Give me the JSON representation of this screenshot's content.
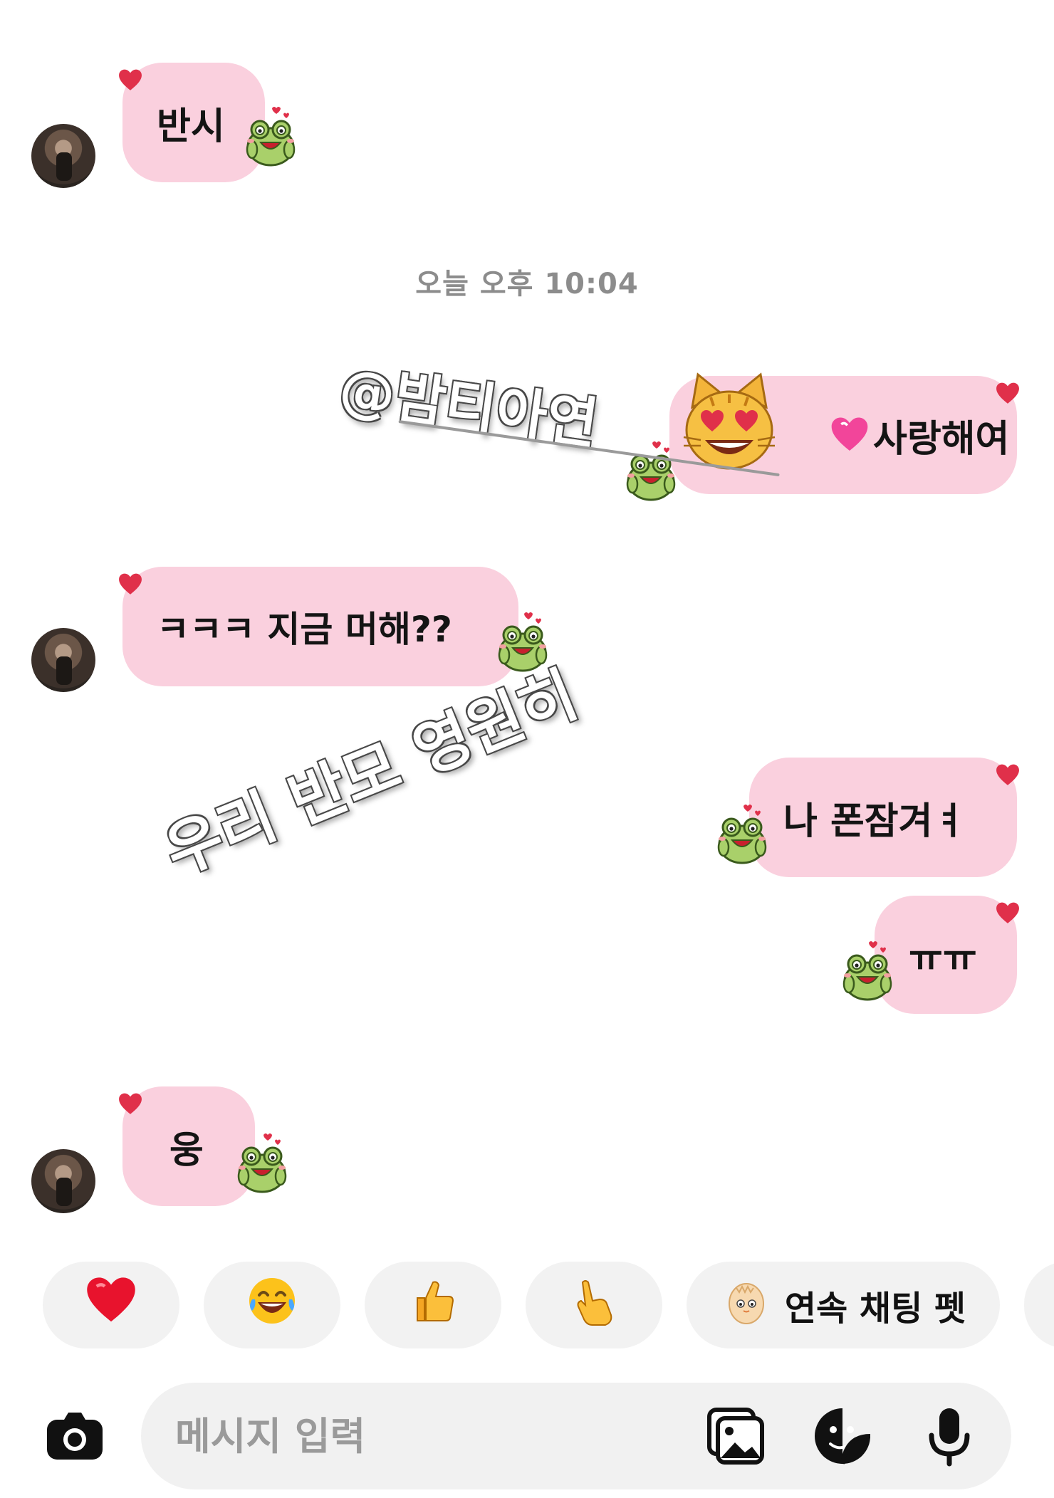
{
  "messages": [
    {
      "side": "incoming",
      "text": "반시"
    },
    {
      "side": "outgoing",
      "text": "사랑해여"
    },
    {
      "side": "incoming",
      "text": "ㅋㅋㅋ 지금 머해??"
    },
    {
      "side": "outgoing",
      "text": "나 폰잠겨ㅕ"
    },
    {
      "side": "outgoing",
      "text": "ㅠㅠ"
    },
    {
      "side": "incoming",
      "text": "웅"
    }
  ],
  "timestamp": "오늘 오후 10:04",
  "overlay": {
    "mention": "@밤티아연",
    "caption": "우리 반모 영원히"
  },
  "quick_reactions": [
    "heart",
    "joy",
    "thumbs-up",
    "pointing-hand"
  ],
  "streak_pet": {
    "label": "연속 채팅 펫"
  },
  "composer": {
    "placeholder": "메시지 입력"
  },
  "colors": {
    "bubble": "#fad0de",
    "heart": "#e0304a",
    "timestamp": "#8c8c8c",
    "chip": "#f2f2f2",
    "composer": "#f1f1f1"
  }
}
